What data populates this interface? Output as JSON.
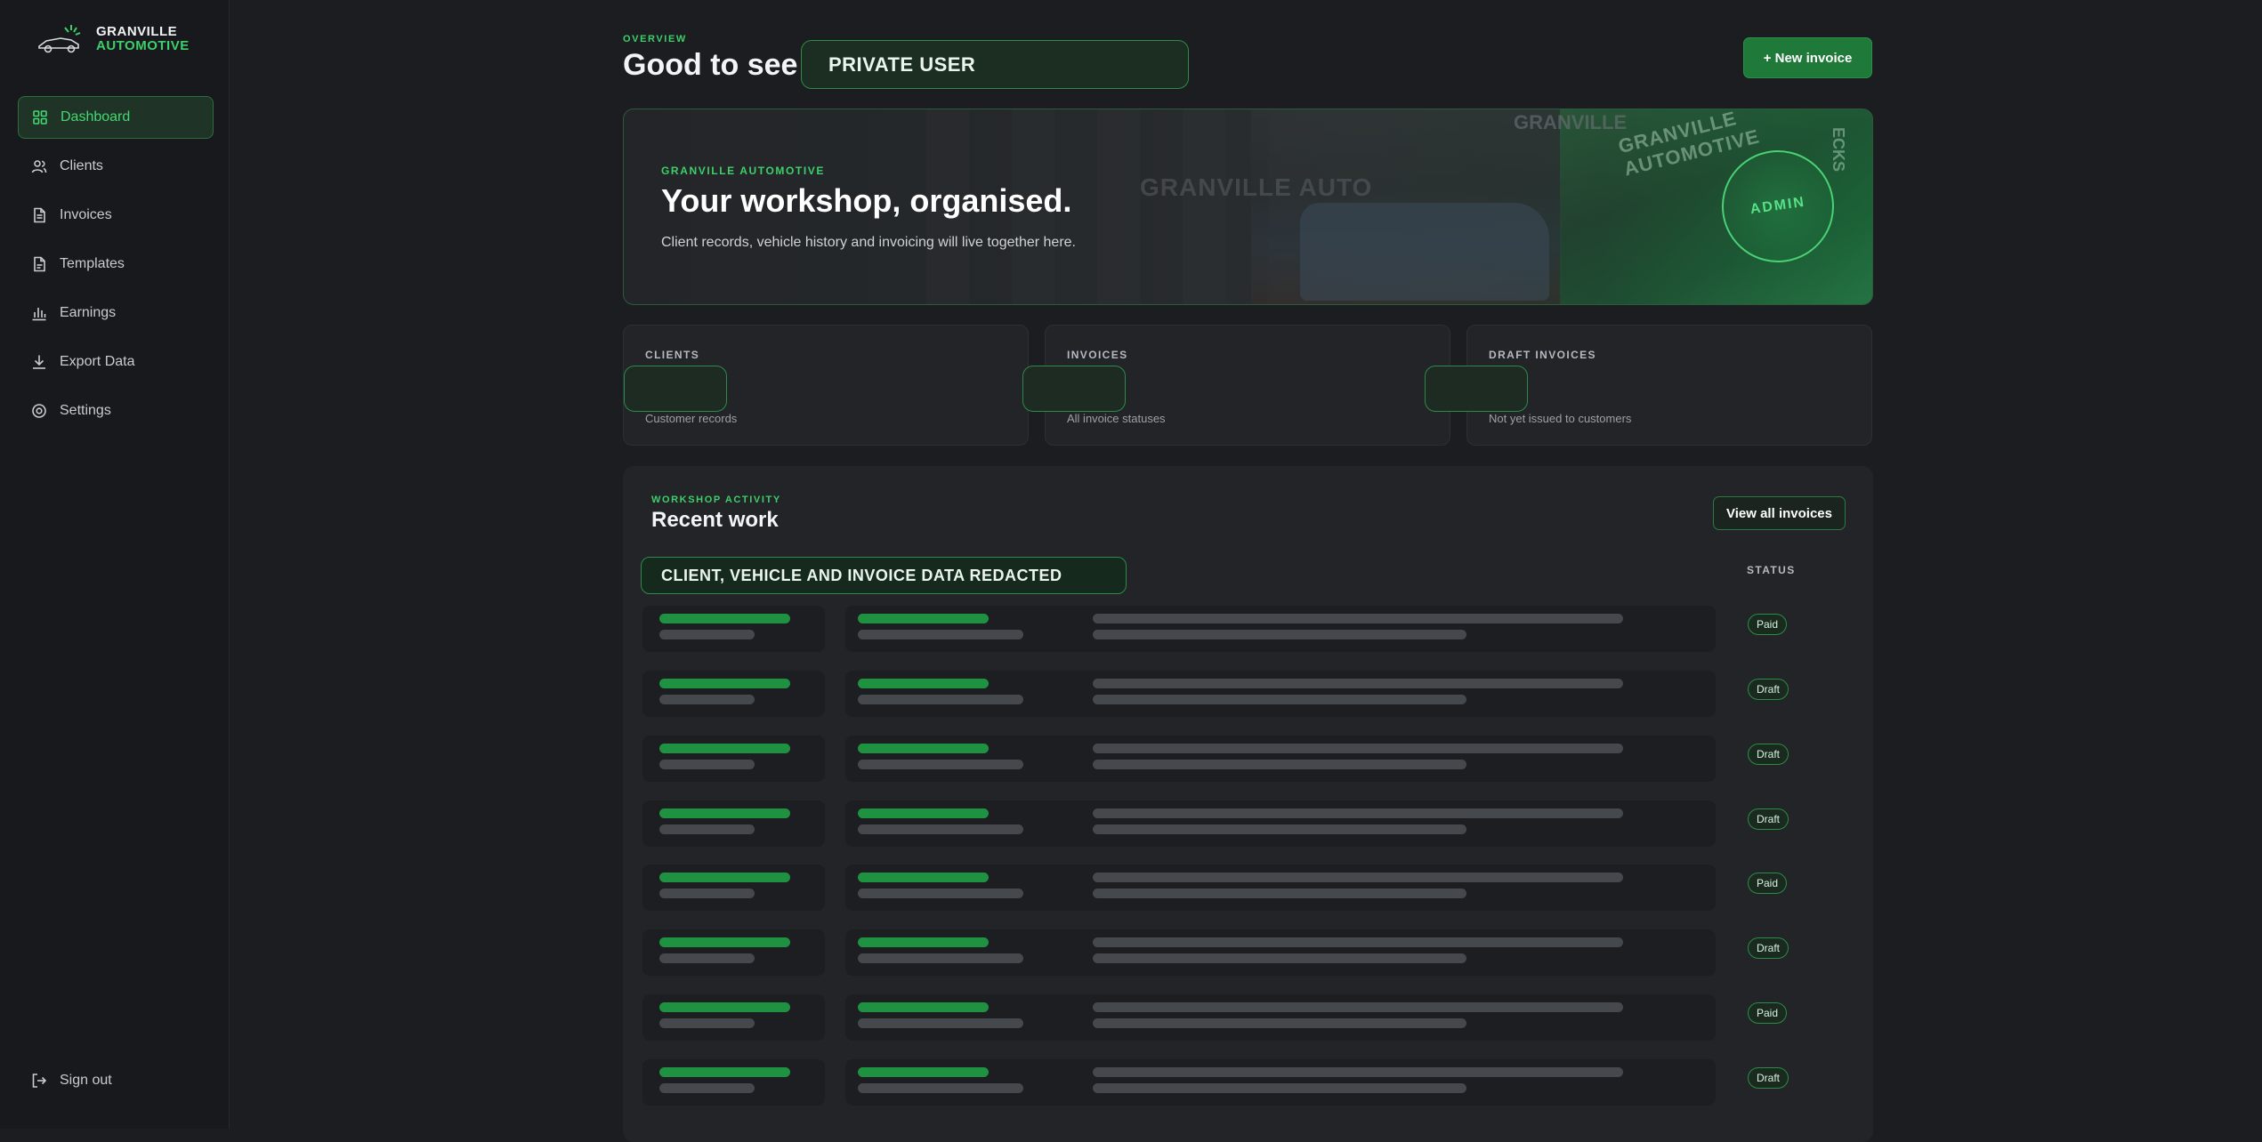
{
  "brand": {
    "line1": "GRANVILLE",
    "line2": "AUTOMOTIVE"
  },
  "nav": [
    {
      "label": "Dashboard",
      "icon": "grid-icon",
      "active": true
    },
    {
      "label": "Clients",
      "icon": "users-icon"
    },
    {
      "label": "Invoices",
      "icon": "document-icon"
    },
    {
      "label": "Templates",
      "icon": "template-icon"
    },
    {
      "label": "Earnings",
      "icon": "bar-chart-icon"
    },
    {
      "label": "Export Data",
      "icon": "download-icon"
    },
    {
      "label": "Settings",
      "icon": "gear-icon"
    }
  ],
  "signout": {
    "label": "Sign out",
    "icon": "logout-icon"
  },
  "header": {
    "kicker": "OVERVIEW",
    "title": "Good to see y",
    "redacted_user": "PRIVATE USER",
    "new_invoice_label": "+ New invoice"
  },
  "hero": {
    "kicker": "GRANVILLE AUTOMOTIVE",
    "title": "Your workshop, organised.",
    "subtitle": "Client records, vehicle history and invoicing will live together here.",
    "badge": "ADMIN",
    "sign_a": "GRANVILLE",
    "sign_b": "GRANVILLE AUTO",
    "sign_c": "GRANVILLE AUTOMOTIVE",
    "sign_d": "ECKS"
  },
  "stats": [
    {
      "label": "CLIENTS",
      "hint": "Customer records"
    },
    {
      "label": "INVOICES",
      "hint": "All invoice statuses"
    },
    {
      "label": "DRAFT INVOICES",
      "hint": "Not yet issued to customers"
    }
  ],
  "activity": {
    "kicker": "WORKSHOP ACTIVITY",
    "title": "Recent work",
    "view_all_label": "View all invoices",
    "redacted_notice": "CLIENT, VEHICLE AND INVOICE DATA REDACTED",
    "status_header": "STATUS",
    "rows": [
      {
        "status": "Paid"
      },
      {
        "status": "Draft"
      },
      {
        "status": "Draft"
      },
      {
        "status": "Draft"
      },
      {
        "status": "Paid"
      },
      {
        "status": "Draft"
      },
      {
        "status": "Paid"
      },
      {
        "status": "Draft"
      }
    ]
  },
  "colors": {
    "accent": "#3ecf6a",
    "primary_button": "#1f7a3a",
    "background": "#1b1d21",
    "sidebar": "#17191c",
    "card": "#222428"
  }
}
